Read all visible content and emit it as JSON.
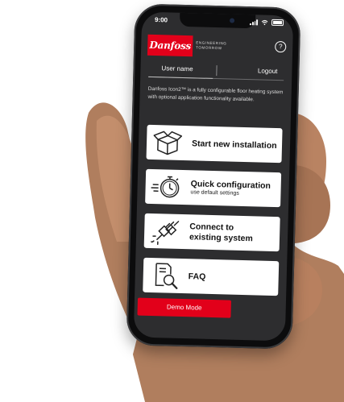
{
  "status": {
    "time": "9:00"
  },
  "brand": {
    "logo_text": "Danfoss",
    "tagline_line1": "ENGINEERING",
    "tagline_line2": "TOMORROW",
    "accent": "#e2001a"
  },
  "header": {
    "help_label": "?"
  },
  "userbar": {
    "username": "User name",
    "logout": "Logout"
  },
  "intro": "Danfoss Icon2™ is a fully configurable floor heating system with optional application functionality available.",
  "cards": [
    {
      "title": "Start new installation",
      "subtitle": "",
      "icon": "box-icon"
    },
    {
      "title": "Quick configuration",
      "subtitle": "use default settings",
      "icon": "stopwatch-icon"
    },
    {
      "title_line1": "Connect to",
      "title_line2": "existing system",
      "icon": "plug-icon"
    },
    {
      "title": "FAQ",
      "subtitle": "",
      "icon": "document-search-icon"
    }
  ],
  "demo_button": "Demo Mode"
}
